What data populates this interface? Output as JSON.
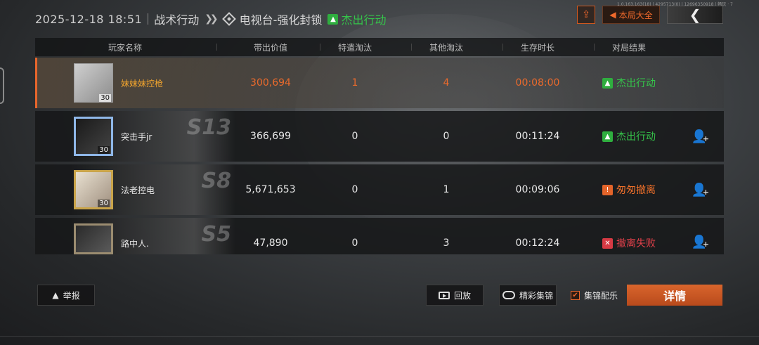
{
  "header": {
    "datetime": "2025-12-18 18:51",
    "mode": "战术行动",
    "map": "电视台-强化封锁",
    "result": "杰出行动"
  },
  "topbar": {
    "match_total_label": "本局大全",
    "tiny_info": "1.0.163.163(18) | 4295713(0) | 12696350918 | 畅玩 · 7"
  },
  "table": {
    "columns": [
      "玩家名称",
      "带出价值",
      "特遣淘汰",
      "其他淘汰",
      "生存时长",
      "对局结果"
    ],
    "rows": [
      {
        "name": "妹妹妹控枪",
        "level": "30",
        "value": "300,694",
        "special_elim": "1",
        "other_elim": "4",
        "survival": "00:08:00",
        "result": "杰出行动",
        "result_color": "#35c44a",
        "is_self": true,
        "season": ""
      },
      {
        "name": "突击手jr",
        "level": "30",
        "value": "366,699",
        "special_elim": "0",
        "other_elim": "0",
        "survival": "00:11:24",
        "result": "杰出行动",
        "result_color": "#35c44a",
        "is_self": false,
        "season": "S13"
      },
      {
        "name": "法老控电",
        "level": "30",
        "value": "5,671,653",
        "special_elim": "0",
        "other_elim": "1",
        "survival": "00:09:06",
        "result": "匆匆撤离",
        "result_color": "#f0702a",
        "is_self": false,
        "season": "S8"
      },
      {
        "name": "路中人.",
        "level": "",
        "value": "47,890",
        "special_elim": "0",
        "other_elim": "3",
        "survival": "00:12:24",
        "result": "撤离失败",
        "result_color": "#e0404a",
        "is_self": false,
        "season": "S5"
      }
    ]
  },
  "bottom": {
    "report": "举报",
    "replay": "回放",
    "highlights": "精彩集锦",
    "highlight_music": "集锦配乐",
    "highlight_music_checked": true,
    "details": "详情"
  },
  "colors": {
    "accent": "#e8662c",
    "success": "#35c44a",
    "warning": "#f0702a",
    "fail": "#e0404a"
  }
}
